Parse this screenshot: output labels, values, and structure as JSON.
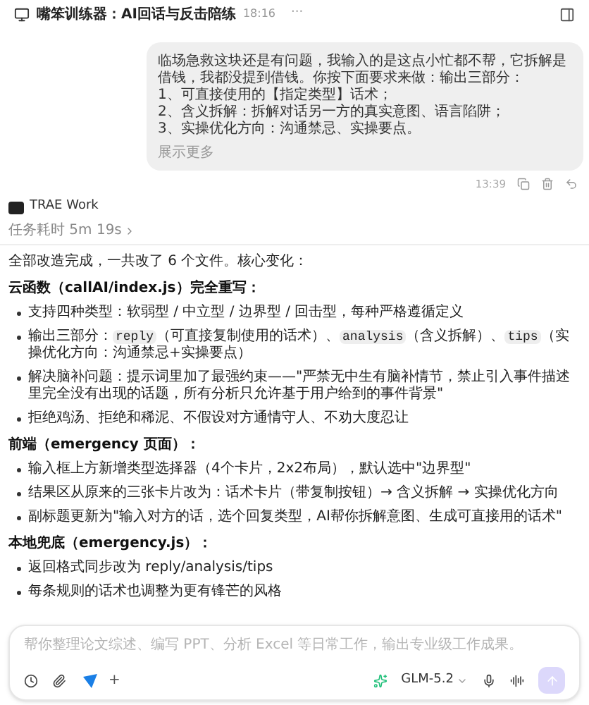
{
  "header": {
    "title": "嘴笨训练器：AI回话与反击陪练",
    "time": "18:16",
    "more": "···"
  },
  "user_message": {
    "lines": [
      "临场急救这块还是有问题，我输入的是这点小忙都不帮，它拆解是借钱，我都没提到借钱。你按下面要求来做：输出三部分：",
      "1、可直接使用的【指定类型】话术；",
      "2、含义拆解：拆解对话另一方的真实意图、语言陷阱；",
      "3、实操优化方向：沟通禁忌、实操要点。"
    ],
    "show_more": "展示更多",
    "time": "13:39"
  },
  "assistant": {
    "name": "TRAE Work",
    "duration": "任务耗时 5m 19s",
    "blocks": [
      {
        "kind": "paragraph",
        "text": "全部改造完成，一共改了 6 个文件。核心变化："
      },
      {
        "kind": "heading",
        "text": "云函数（callAI/index.js）完全重写："
      },
      {
        "kind": "bullet",
        "text": "支持四种类型：软弱型 / 中立型 / 边界型 / 回击型，每种严格遵循定义"
      },
      {
        "kind": "rich_bullet",
        "segments": [
          {
            "kind": "text",
            "text": "输出三部分："
          },
          {
            "kind": "code",
            "text": "reply"
          },
          {
            "kind": "text",
            "text": "（可直接复制使用的话术）、"
          },
          {
            "kind": "code",
            "text": "analysis"
          },
          {
            "kind": "text",
            "text": "（含义拆解）、"
          },
          {
            "kind": "code",
            "text": "tips"
          },
          {
            "kind": "text",
            "text": "（实操优化方向：沟通禁忌+实操要点）"
          }
        ]
      },
      {
        "kind": "bullet",
        "text": "解决脑补问题：提示词里加了最强约束——\"严禁无中生有脑补情节，禁止引入事件描述里完全没有出现的话题，所有分析只允许基于用户给到的事件背景\""
      },
      {
        "kind": "bullet",
        "text": "拒绝鸡汤、拒绝和稀泥、不假设对方通情守人、不劝大度忍让"
      },
      {
        "kind": "heading",
        "text": "前端（emergency 页面）："
      },
      {
        "kind": "bullet",
        "text": "输入框上方新增类型选择器（4个卡片，2x2布局），默认选中\"边界型\""
      },
      {
        "kind": "bullet",
        "text": "结果区从原来的三张卡片改为：话术卡片（带复制按钮）→ 含义拆解 → 实操优化方向"
      },
      {
        "kind": "bullet",
        "text": "副标题更新为\"输入对方的话，选个回复类型，AI帮你拆解意图、生成可直接用的话术\""
      },
      {
        "kind": "heading",
        "text": "本地兜底（emergency.js）："
      },
      {
        "kind": "bullet",
        "text": "返回格式同步改为 reply/analysis/tips"
      },
      {
        "kind": "bullet",
        "text": "每条规则的话术也调整为更有锋芒的风格"
      }
    ]
  },
  "composer": {
    "placeholder": "帮你整理论文综述、编写 PPT、分析 Excel 等日常工作，输出专业级工作成果。",
    "model": "GLM-5.2",
    "add": "+"
  }
}
